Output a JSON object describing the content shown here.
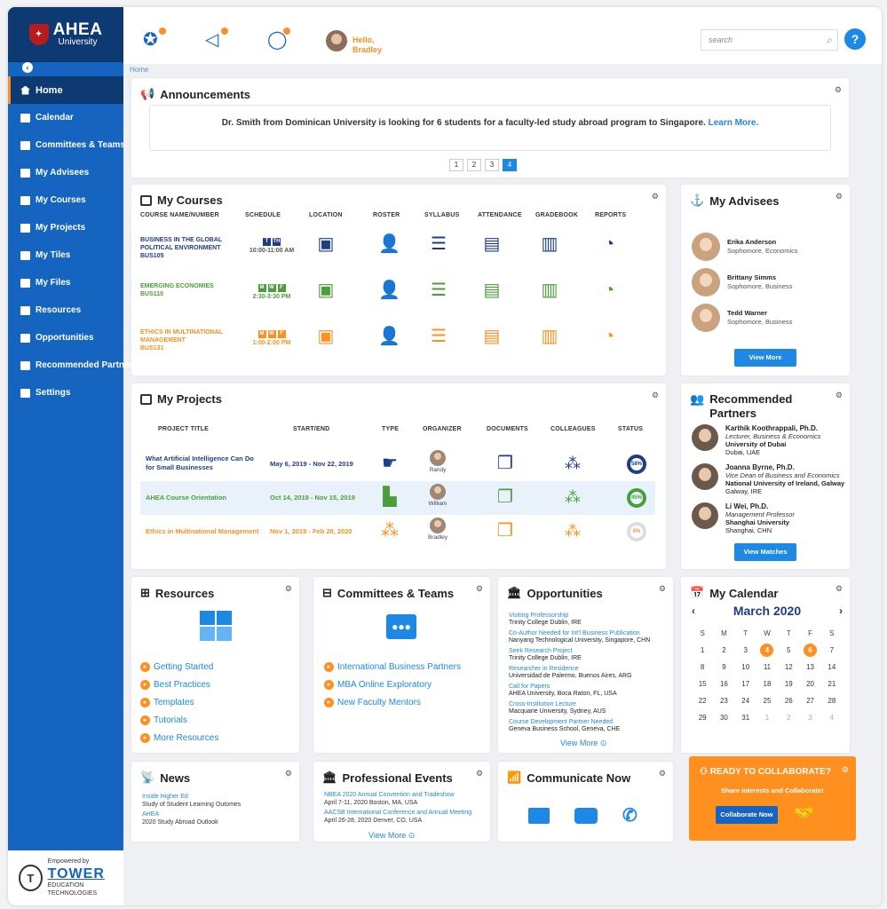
{
  "brand": {
    "name": "AHEA",
    "sub": "University"
  },
  "sidebar": {
    "items": [
      {
        "label": "Home",
        "active": true,
        "icon": "home-icon"
      },
      {
        "label": "Calendar",
        "icon": "calendar-icon"
      },
      {
        "label": "Committees & Teams",
        "icon": "committees-icon"
      },
      {
        "label": "My Advisees",
        "icon": "advisees-icon"
      },
      {
        "label": "My Courses",
        "icon": "courses-icon"
      },
      {
        "label": "My Projects",
        "icon": "projects-icon"
      },
      {
        "label": "My Tiles",
        "icon": "tiles-icon"
      },
      {
        "label": "My Files",
        "icon": "files-icon"
      },
      {
        "label": "Resources",
        "icon": "resources-icon"
      },
      {
        "label": "Opportunities",
        "icon": "opportunities-icon"
      },
      {
        "label": "Recommended Partners",
        "icon": "partners-icon"
      },
      {
        "label": "Settings",
        "icon": "settings-icon"
      }
    ],
    "footer": {
      "empowered": "Empowered by",
      "name": "TOWER",
      "sub": "EDUCATION TECHNOLOGIES"
    }
  },
  "header": {
    "greeting": "Hello,",
    "user": "Bradley",
    "search_placeholder": "search",
    "help": "?"
  },
  "breadcrumb": "Home",
  "announcements": {
    "title": "Announcements",
    "text": "Dr. Smith from Dominican University is looking for 6 students for a faculty-led study abroad program to Singapore.",
    "link": "Learn More.",
    "pages": [
      "1",
      "2",
      "3",
      "4"
    ],
    "active_page": "4"
  },
  "courses": {
    "title": "My Courses",
    "headers": [
      "COURSE NAME/NUMBER",
      "SCHEDULE",
      "LOCATION",
      "ROSTER",
      "SYLLABUS",
      "ATTENDANCE",
      "GRADEBOOK",
      "REPORTS"
    ],
    "rows": [
      {
        "name": "BUSINESS IN THE GLOBAL POLITICAL ENVIRONMENT",
        "code": "BUS105",
        "days": [
          "T",
          "TH"
        ],
        "time": "10:00-11:00 AM",
        "color": "#1f3c88"
      },
      {
        "name": "EMERGING ECONOMIES",
        "code": "BUS110",
        "days": [
          "M",
          "W",
          "F"
        ],
        "time": "2:30-3:30 PM",
        "color": "#4a9f3a"
      },
      {
        "name": "ETHICS IN MULTINATIONAL MANAGEMENT",
        "code": "BUS131",
        "days": [
          "M",
          "W",
          "F"
        ],
        "time": "1:00-2:00 PM",
        "color": "#ff8f1f"
      }
    ]
  },
  "advisees": {
    "title": "My Advisees",
    "people": [
      {
        "name": "Erika Anderson",
        "info": "Sophomore, Economics"
      },
      {
        "name": "Brittany Simms",
        "info": "Sophomore, Business"
      },
      {
        "name": "Tedd Warner",
        "info": "Sophomore, Business"
      }
    ],
    "button": "View More"
  },
  "projects": {
    "title": "My Projects",
    "headers": [
      "PROJECT TITLE",
      "START/END",
      "TYPE",
      "ORGANIZER",
      "DOCUMENTS",
      "COLLEAGUES",
      "STATUS"
    ],
    "rows": [
      {
        "title": "What Artificial Intelligence Can Do for Small Businesses",
        "dates": "May 6, 2019 - Nov 22, 2019",
        "organizer": "Randy",
        "status": "58%",
        "color": "#1f3c88"
      },
      {
        "title": "AHEA Course Orientation",
        "dates": "Oct 14, 2019 - Nov 15, 2019",
        "organizer": "William",
        "status": "45%",
        "color": "#4a9f3a"
      },
      {
        "title": "Ethics in Multinational Management",
        "dates": "Nov 1, 2019 - Feb 28, 2020",
        "organizer": "Bradley",
        "status": "0%",
        "color": "#ff8f1f"
      }
    ]
  },
  "partners": {
    "title": "Recommended Partners",
    "people": [
      {
        "name": "Karthik Koothrappali, Ph.D.",
        "role": "Lecturer, Business & Economics",
        "org": "University of Dubai",
        "loc": "Dubai, UAE"
      },
      {
        "name": "Joanna Byrne, Ph.D.",
        "role": "Vice Dean of Business and Economics",
        "org": "National University of Ireland, Galway",
        "loc": "Galway, IRE"
      },
      {
        "name": "Li Wei, Ph.D.",
        "role": "Management Professor",
        "org": "Shanghai University",
        "loc": "Shanghai, CHN"
      }
    ],
    "button": "View Matches"
  },
  "resources": {
    "title": "Resources",
    "links": [
      "Getting Started",
      "Best Practices",
      "Templates",
      "Tutorials",
      "More Resources"
    ]
  },
  "committees": {
    "title": "Committees & Teams",
    "links": [
      "International Business Partners",
      "MBA Online Exploratory",
      "New Faculty Mentors"
    ]
  },
  "opportunities": {
    "title": "Opportunities",
    "items": [
      {
        "title": "Visiting Professorship",
        "place": "Trinity College Dublin, IRE"
      },
      {
        "title": "Co-Author Needed for Int'l Business Publication",
        "place": "Nanyang Technological University, Singapore, CHN"
      },
      {
        "title": "Seek Research Project",
        "place": "Trinity College Dublin, IRE"
      },
      {
        "title": "Researcher in Residence",
        "place": "Universidad de Palermo, Buenos Aires, ARG"
      },
      {
        "title": "Call for Papers",
        "place": "AHEA University, Boca Raton, FL, USA"
      },
      {
        "title": "Cross-Institution Lecture",
        "place": "Macquarie University, Sydney, AUS"
      },
      {
        "title": "Course Development Partner Needed",
        "place": "Geneva Business School, Geneva, CHE"
      }
    ],
    "more": "View More"
  },
  "calendar": {
    "title": "My Calendar",
    "month": "March 2020",
    "dow": [
      "S",
      "M",
      "T",
      "W",
      "T",
      "F",
      "S"
    ],
    "days": [
      "1",
      "2",
      "3",
      "4",
      "5",
      "6",
      "7",
      "8",
      "9",
      "10",
      "11",
      "12",
      "13",
      "14",
      "15",
      "16",
      "17",
      "18",
      "19",
      "20",
      "21",
      "22",
      "23",
      "24",
      "25",
      "26",
      "27",
      "28",
      "29",
      "30",
      "31",
      "1",
      "2",
      "3",
      "4"
    ],
    "highlight": [
      "4",
      "6"
    ]
  },
  "news": {
    "title": "News",
    "items": [
      {
        "title": "Inside Higher Ed",
        "text": "Study of Student Learning Outomes"
      },
      {
        "title": "AHEA",
        "text": "2020 Study Abroad Outlook"
      }
    ]
  },
  "events": {
    "title": "Professional Events",
    "items": [
      {
        "title": "NBEA 2020 Annual Convention and Tradeshow",
        "text": "April 7-11, 2020 Boston, MA, USA"
      },
      {
        "title": "AACSB International Conference and Annual Meeting",
        "text": "April 26-28, 2020 Denver, CO, USA"
      }
    ],
    "more": "View More"
  },
  "communicate": {
    "title": "Communicate Now"
  },
  "collaborate": {
    "title": "READY TO COLLABORATE?",
    "sub": "Share Interests and Collaborate!",
    "button": "Collaborate Now"
  },
  "colors": {
    "brand": "#1565c0",
    "accent": "#ff8f1f",
    "green": "#4a9f3a",
    "navy": "#1f3c88"
  }
}
